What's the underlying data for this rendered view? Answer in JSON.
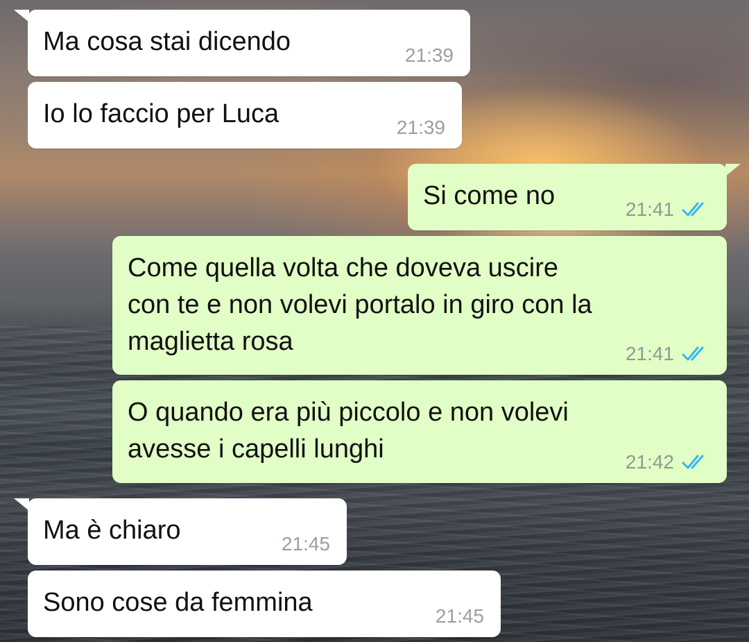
{
  "messages": [
    {
      "text": "Ma cosa stai dicendo",
      "time": "21:39",
      "direction": "incoming"
    },
    {
      "text": "Io lo faccio per Luca",
      "time": "21:39",
      "direction": "incoming"
    },
    {
      "text": "Si come no",
      "time": "21:41",
      "direction": "outgoing",
      "status": "read-double-check-icon"
    },
    {
      "text": "Come quella volta che doveva uscire\ncon te e non volevi portalo in giro con la\nmaglietta rosa",
      "time": "21:41",
      "direction": "outgoing",
      "status": "read-double-check-icon"
    },
    {
      "text": "O quando era più piccolo e non volevi\navesse i capelli lunghi",
      "time": "21:42",
      "direction": "outgoing",
      "status": "read-double-check-icon"
    },
    {
      "text": "Ma è chiaro",
      "time": "21:45",
      "direction": "incoming"
    },
    {
      "text": "Sono cose da femmina",
      "time": "21:45",
      "direction": "incoming"
    }
  ],
  "colors": {
    "incoming_bubble": "#ffffff",
    "outgoing_bubble": "#e1fec6",
    "read_check": "#34b7f1",
    "timestamp": "#8f9a92"
  }
}
